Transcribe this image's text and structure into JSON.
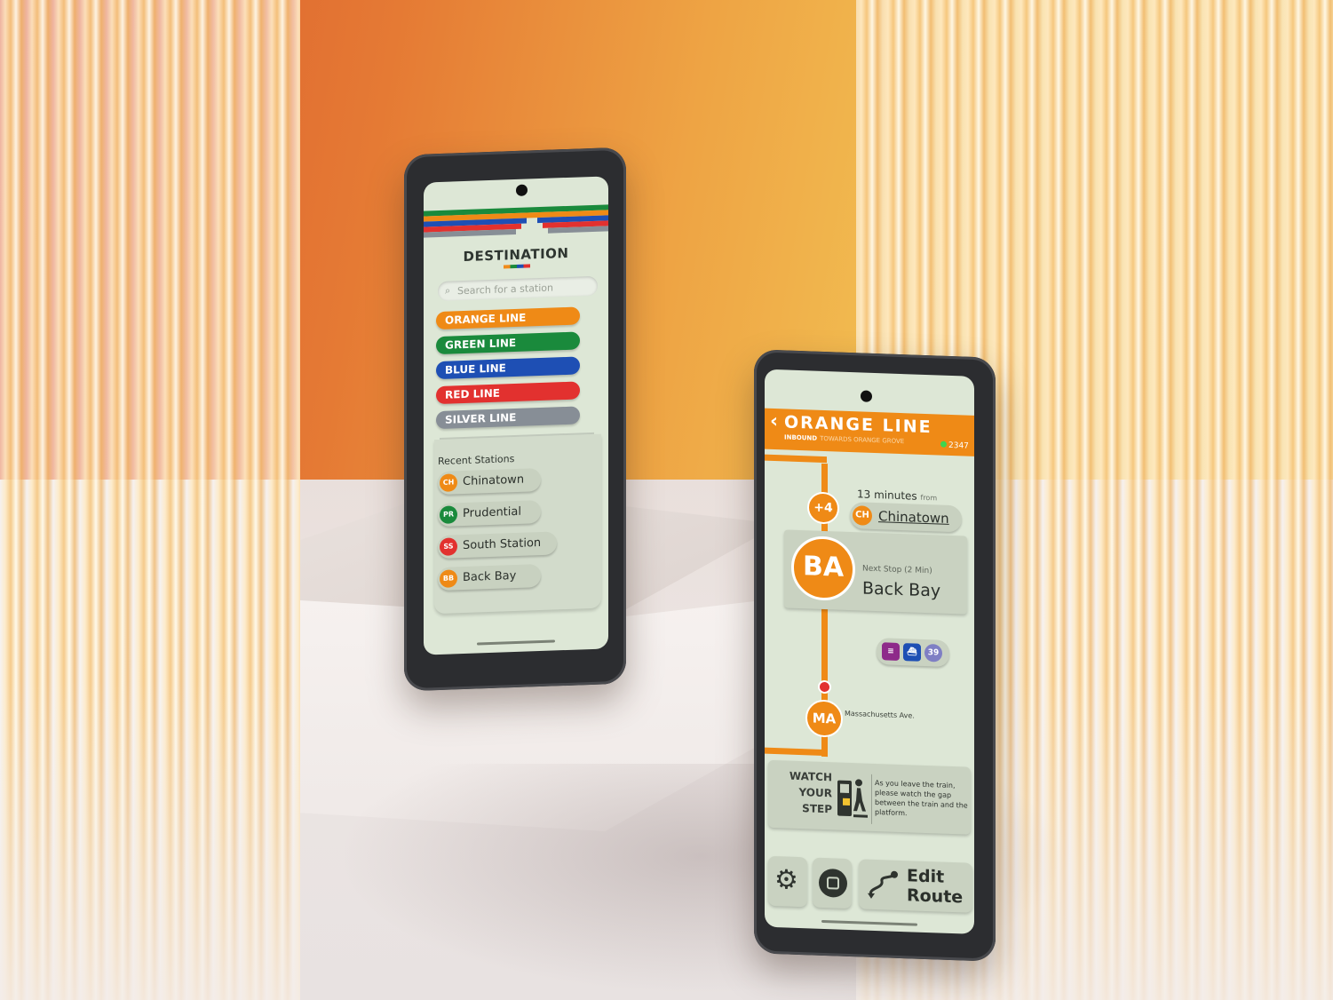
{
  "colors": {
    "orange": "#ef8a16",
    "green": "#1a8a3c",
    "blue": "#1e4fb4",
    "red": "#e2312f",
    "silver": "#878e96",
    "screen_bg": "#dde7d6"
  },
  "destination_screen": {
    "title": "DESTINATION",
    "search": {
      "placeholder": "Search for a station",
      "value": ""
    },
    "lines": [
      {
        "label": "ORANGE LINE",
        "color": "#ef8a16"
      },
      {
        "label": "GREEN LINE",
        "color": "#1a8a3c"
      },
      {
        "label": "BLUE LINE",
        "color": "#1e4fb4"
      },
      {
        "label": "RED LINE",
        "color": "#e2312f"
      },
      {
        "label": "SILVER LINE",
        "color": "#878e96"
      }
    ],
    "recent_title": "Recent Stations",
    "recent": [
      {
        "code": "CH",
        "name": "Chinatown",
        "color": "#ef8a16"
      },
      {
        "code": "PR",
        "name": "Prudential",
        "color": "#1a8a3c"
      },
      {
        "code": "SS",
        "name": "South Station",
        "color": "#e2312f"
      },
      {
        "code": "BB",
        "name": "Back Bay",
        "color": "#ef8a16"
      }
    ]
  },
  "trip_screen": {
    "line_title": "ORANGE LINE",
    "direction": "INBOUND",
    "toward": "TOWARDS ORANGE GROVE",
    "train_id": "2347",
    "delay": "+4",
    "minutes_text": "13 minutes",
    "from_word": "from",
    "from_station": {
      "code": "CH",
      "name": "Chinatown"
    },
    "next_stop": {
      "code": "BA",
      "label": "Next Stop (2 Min)",
      "name": "Back Bay"
    },
    "connections": [
      {
        "label": "≡",
        "color": "#8e2a8a"
      },
      {
        "label": "⛴",
        "color": "#1e4fb4"
      },
      {
        "label": "39",
        "color": "#7f7fc4"
      }
    ],
    "later_stop": {
      "code": "MA",
      "name": "Massachusetts Ave."
    },
    "warning": {
      "line1": "WATCH",
      "line2": "YOUR",
      "line3": "STEP",
      "text": "As you leave the train, please watch the gap between the train and the platform."
    },
    "edit_line1": "Edit",
    "edit_line2": "Route"
  }
}
